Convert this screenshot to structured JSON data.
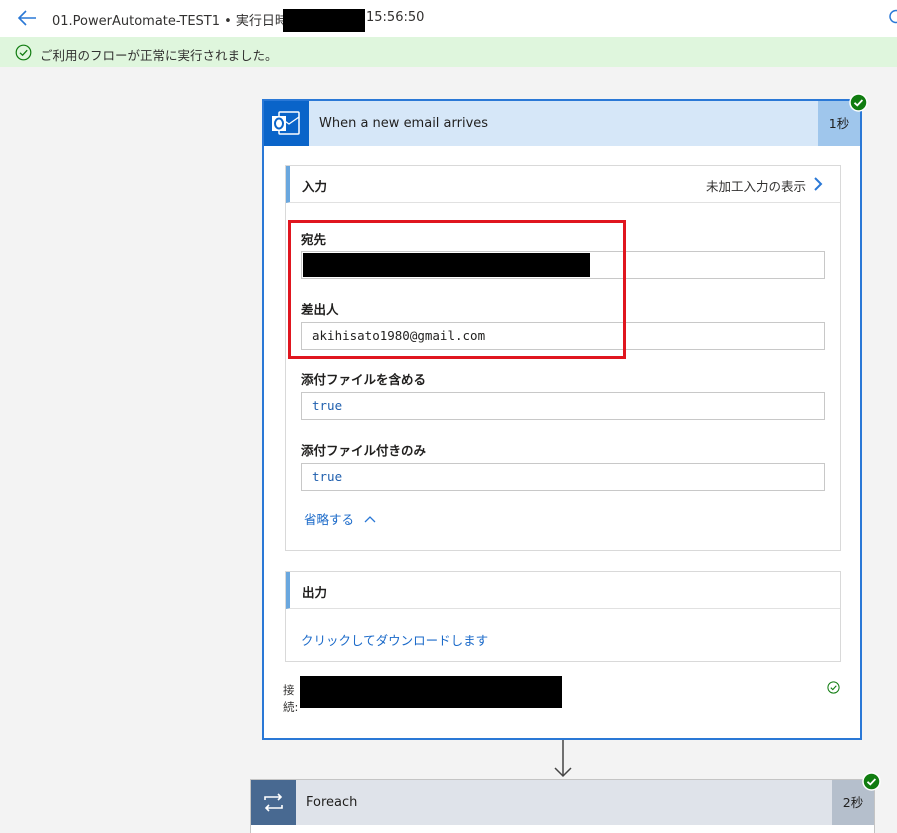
{
  "header": {
    "title": "01.PowerAutomate-TEST1 • 実行日時",
    "time": "15:56:50"
  },
  "banner": {
    "message": "ご利用のフローが正常に実行されました。",
    "color": "#dff6dd"
  },
  "trigger": {
    "title": "When a new email arrives",
    "duration": "1秒",
    "icon": "outlook-icon",
    "accent": "#0a64c9",
    "inputs": {
      "heading": "入力",
      "raw_link": "未加工入力の表示",
      "fields": [
        {
          "label": "宛先",
          "value": ""
        },
        {
          "label": "差出人",
          "value": "akihisato1980@gmail.com"
        },
        {
          "label": "添付ファイルを含める",
          "value": "true"
        },
        {
          "label": "添付ファイル付きのみ",
          "value": "true"
        }
      ],
      "collapse_link": "省略する"
    },
    "outputs": {
      "heading": "出力",
      "download_link": "クリックしてダウンロードします"
    },
    "connection_label": "接続:"
  },
  "foreach": {
    "title": "Foreach",
    "duration": "2秒",
    "icon": "loop-icon",
    "accent": "#486991"
  },
  "colors": {
    "success": "#107c10",
    "link": "#1b6ac9",
    "highlight_frame": "#e0161f"
  }
}
